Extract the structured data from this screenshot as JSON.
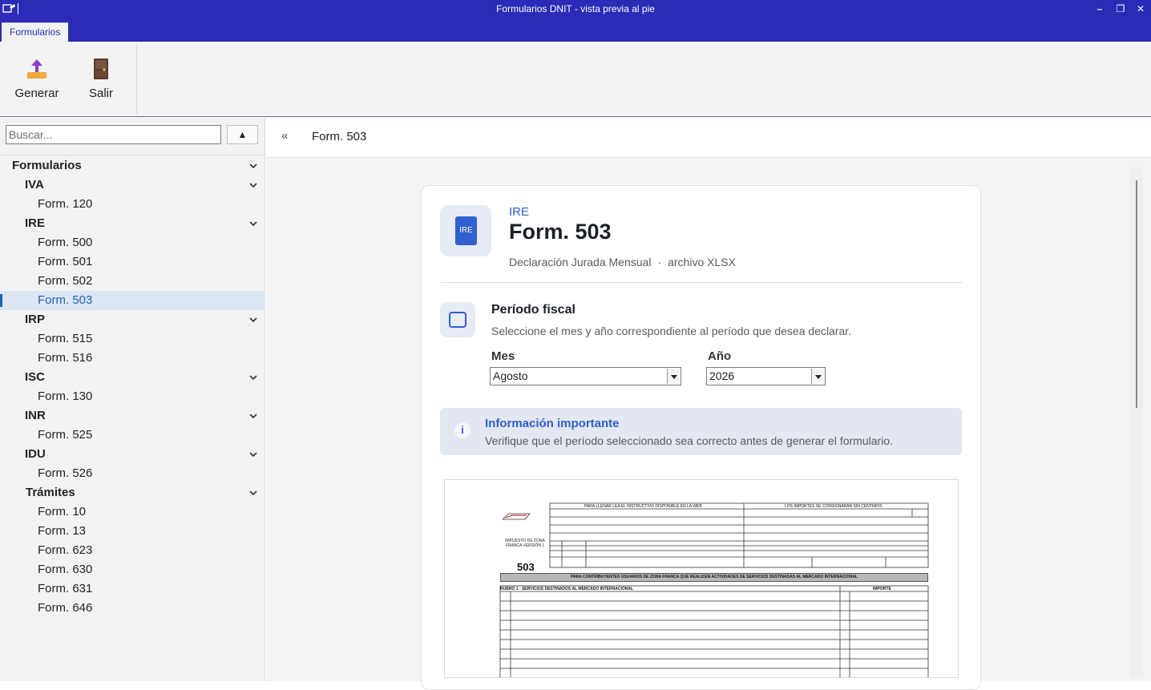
{
  "window": {
    "title": "Formularios DNIT - vista previa al pie",
    "minimize": "–",
    "restore": "❐",
    "close": "✕"
  },
  "ribbon": {
    "tab": "Formularios",
    "buttons": [
      {
        "label": "Generar",
        "icon": "upload-icon"
      },
      {
        "label": "Salir",
        "icon": "exit-door-icon"
      }
    ]
  },
  "sidebar": {
    "search_placeholder": "Buscar...",
    "collapse_glyph": "▲",
    "tree": {
      "root": "Formularios",
      "groups": [
        {
          "label": "IVA",
          "items": [
            "Form. 120"
          ]
        },
        {
          "label": "IRE",
          "items": [
            "Form. 500",
            "Form. 501",
            "Form. 502",
            "Form. 503"
          ]
        },
        {
          "label": "IRP",
          "items": [
            "Form. 515",
            "Form. 516"
          ]
        },
        {
          "label": "ISC",
          "items": [
            "Form. 130"
          ]
        },
        {
          "label": "INR",
          "items": [
            "Form. 525"
          ]
        },
        {
          "label": "IDU",
          "items": [
            "Form. 526"
          ]
        },
        {
          "label": "Trámites",
          "items": [
            "Form. 10",
            "Form. 13",
            "Form. 623",
            "Form. 630",
            "Form. 631",
            "Form. 646"
          ]
        }
      ],
      "selected": "Form. 503"
    }
  },
  "header": {
    "back": "«",
    "crumb": "Form. 503"
  },
  "card": {
    "badge": "IRE",
    "category": "IRE",
    "title": "Form. 503",
    "meta_desc": "Declaración Jurada Mensual",
    "meta_sep": "·",
    "meta_file": "archivo XLSX",
    "period": {
      "title": "Período fiscal",
      "desc": "Seleccione el mes y año correspondiente al período que desea declarar.",
      "month_label": "Mes",
      "month_value": "Agosto",
      "year_label": "Año",
      "year_value": "2026"
    },
    "info": {
      "icon": "i",
      "title": "Información importante",
      "desc": "Verifique que el período seleccionado sea correcto antes de generar el formulario."
    },
    "preview": {
      "form_number": "503",
      "side_label": "IMPUESTO DE ZONA FRANCA VERSIÓN 1",
      "header_left": "PARA LLENAR LEA EL INSTRUCTIVO DISPONIBLE EN LA WEB",
      "header_right": "LOS IMPORTES SE CONSIGNARÁN SIN CÉNTIMOS",
      "band": "PARA CONTRIBUYENTES USUARIOS DE ZONA FRANCA QUE REALICEN ACTIVIDADES DE SERVICIOS DESTINADAS AL MERCADO INTERNACIONAL",
      "rubro": "RUBRO 1 - SERVICIOS DESTINADOS AL MERCADO INTERNACIONAL",
      "importe": "IMPORTE"
    }
  }
}
